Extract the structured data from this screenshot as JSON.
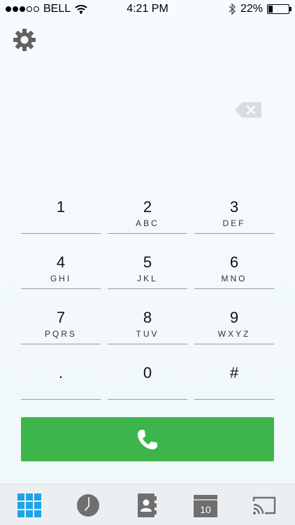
{
  "status_bar": {
    "carrier": "BELL",
    "time": "4:21 PM",
    "battery": "22%",
    "battery_level": 0.22,
    "signal_bars": 3,
    "signal_total": 5
  },
  "icons": {
    "settings": "gear-icon",
    "backspace": "backspace-icon",
    "call": "phone-icon"
  },
  "keypad": {
    "keys": [
      {
        "digit": "1",
        "letters": ""
      },
      {
        "digit": "2",
        "letters": "ABC"
      },
      {
        "digit": "3",
        "letters": "DEF"
      },
      {
        "digit": "4",
        "letters": "GHI"
      },
      {
        "digit": "5",
        "letters": "JKL"
      },
      {
        "digit": "6",
        "letters": "MNO"
      },
      {
        "digit": "7",
        "letters": "PQRS"
      },
      {
        "digit": "8",
        "letters": "TUV"
      },
      {
        "digit": "9",
        "letters": "WXYZ"
      },
      {
        "digit": ".",
        "letters": ""
      },
      {
        "digit": "0",
        "letters": ""
      },
      {
        "digit": "#",
        "letters": ""
      }
    ]
  },
  "tabbar": {
    "calendar_day": "10",
    "tabs": [
      "keypad-icon",
      "clock-icon",
      "contacts-icon",
      "calendar-icon",
      "cast-icon"
    ]
  },
  "colors": {
    "call_green": "#3cb54a",
    "active_tab_blue": "#1ea1e6",
    "icon_gray": "#6f6f6f"
  }
}
